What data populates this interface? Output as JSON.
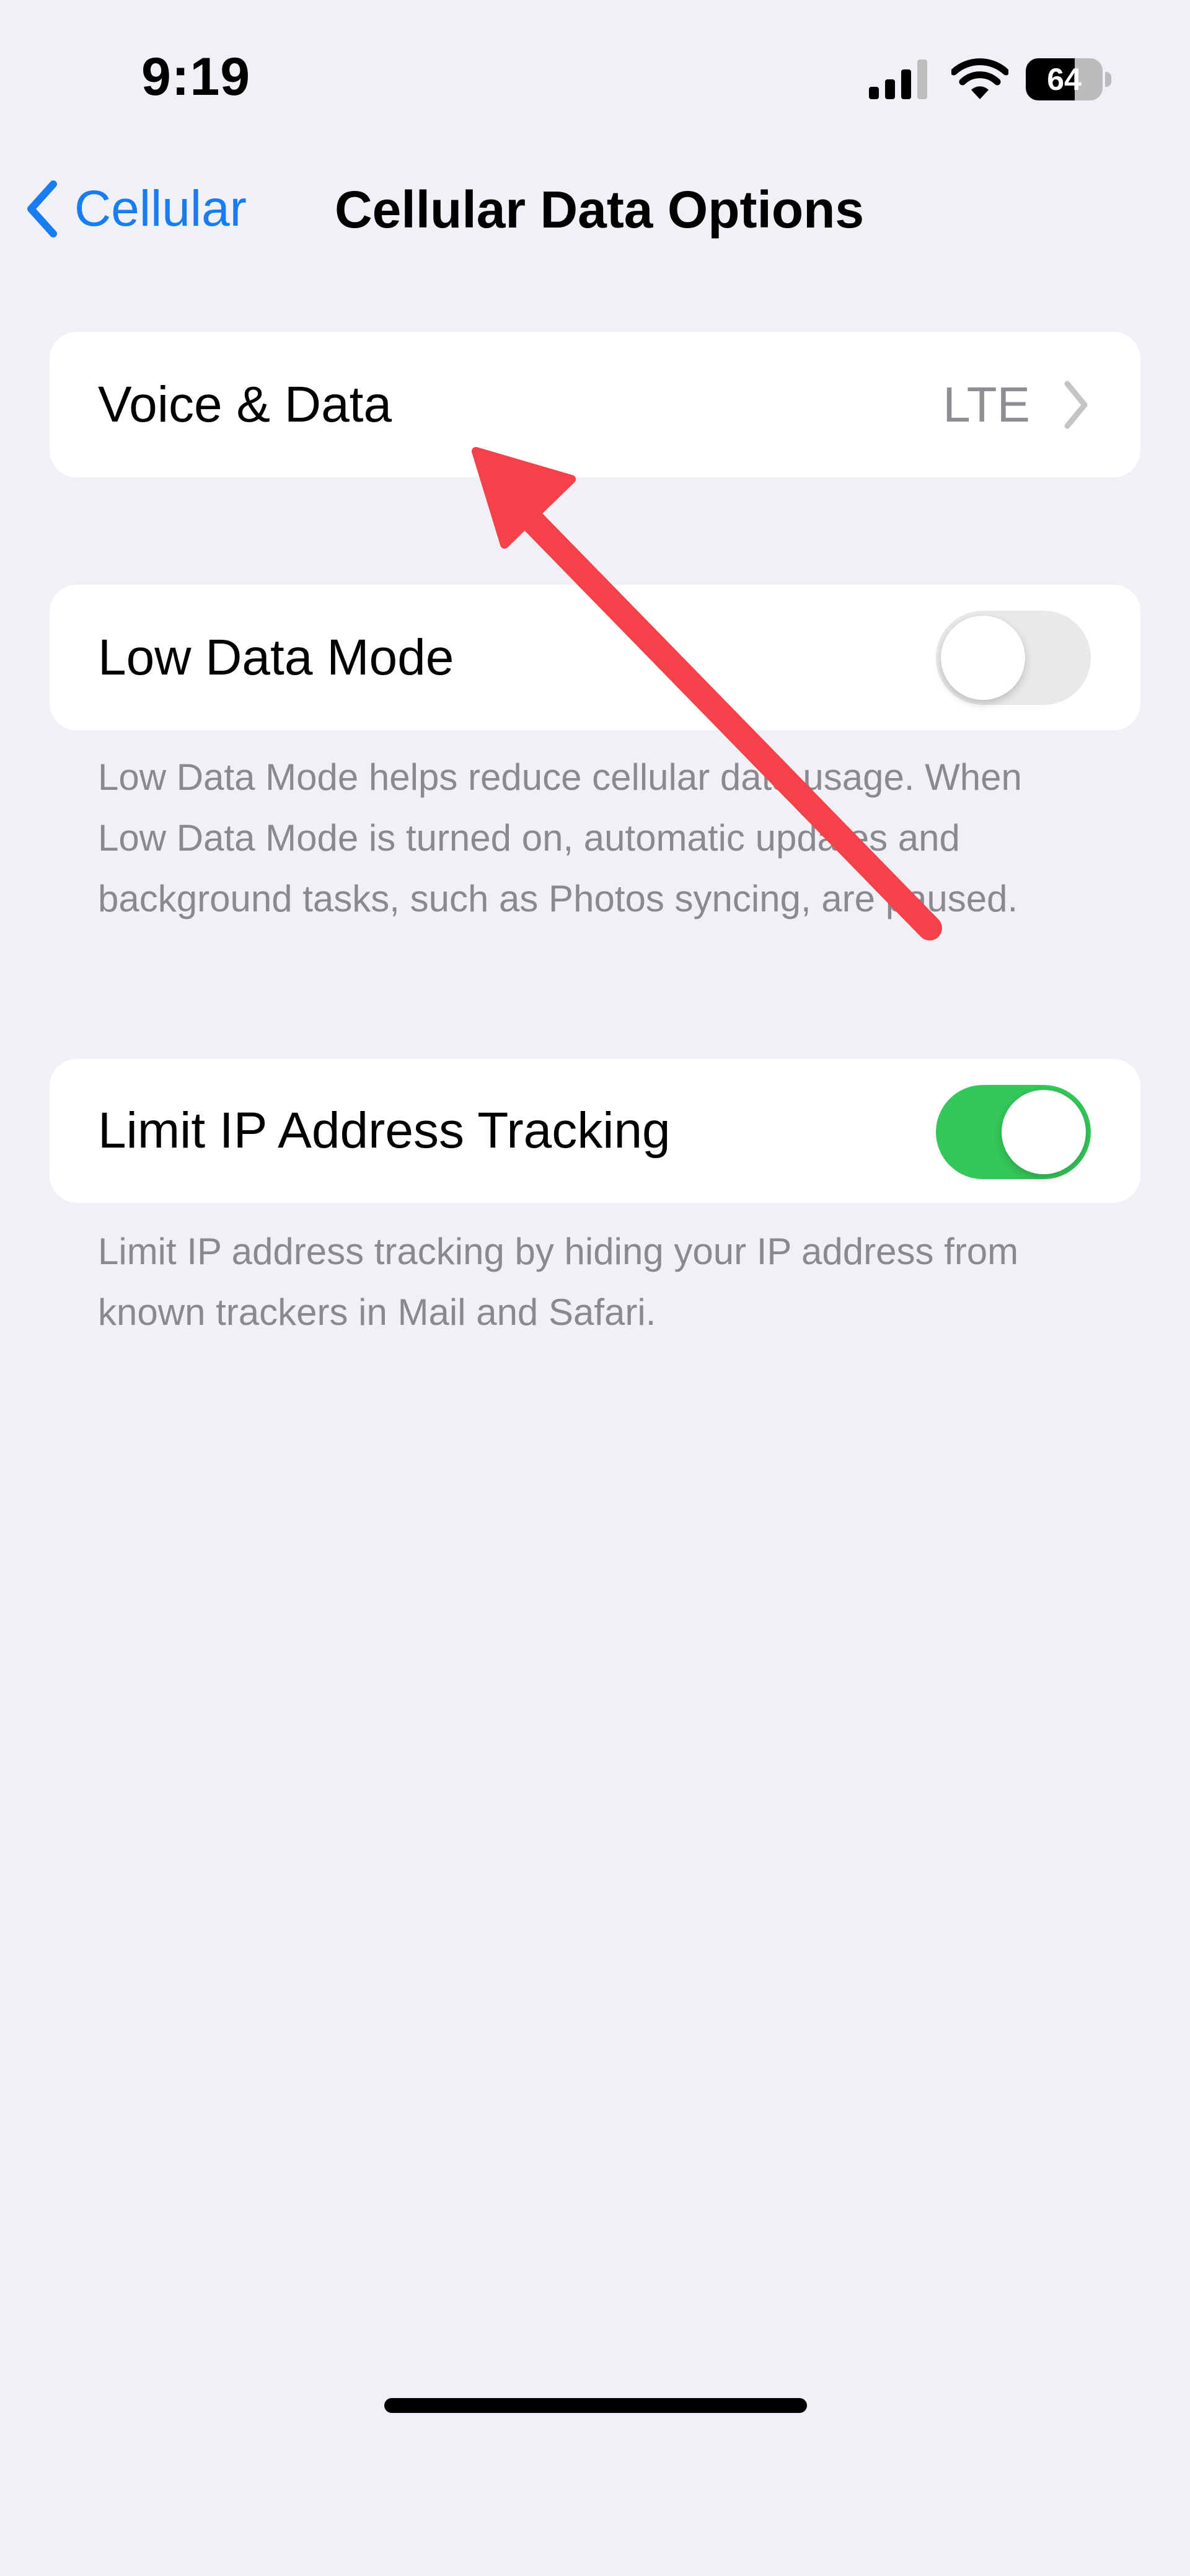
{
  "status_bar": {
    "time": "9:19",
    "battery_level": "64",
    "icons": [
      "cellular-signal-icon",
      "wifi-icon",
      "battery-icon"
    ]
  },
  "nav": {
    "back_label": "Cellular",
    "title": "Cellular Data Options"
  },
  "rows": {
    "voice_data": {
      "label": "Voice & Data",
      "value": "LTE"
    },
    "low_data_mode": {
      "label": "Low Data Mode",
      "enabled": false,
      "footnote": "Low Data Mode helps reduce cellular data usage. When Low Data Mode is turned on, automatic updates and background tasks, such as Photos syncing, are paused."
    },
    "limit_ip": {
      "label": "Limit IP Address Tracking",
      "enabled": true,
      "footnote": "Limit IP address tracking by hiding your IP address from known trackers in Mail and Safari."
    }
  },
  "colors": {
    "accent": "#1A7CF3",
    "toggle_on": "#34C759",
    "toggle_off": "#E9E9EB",
    "annotation_arrow": "#F5414A",
    "background": "#F0F1F7"
  }
}
